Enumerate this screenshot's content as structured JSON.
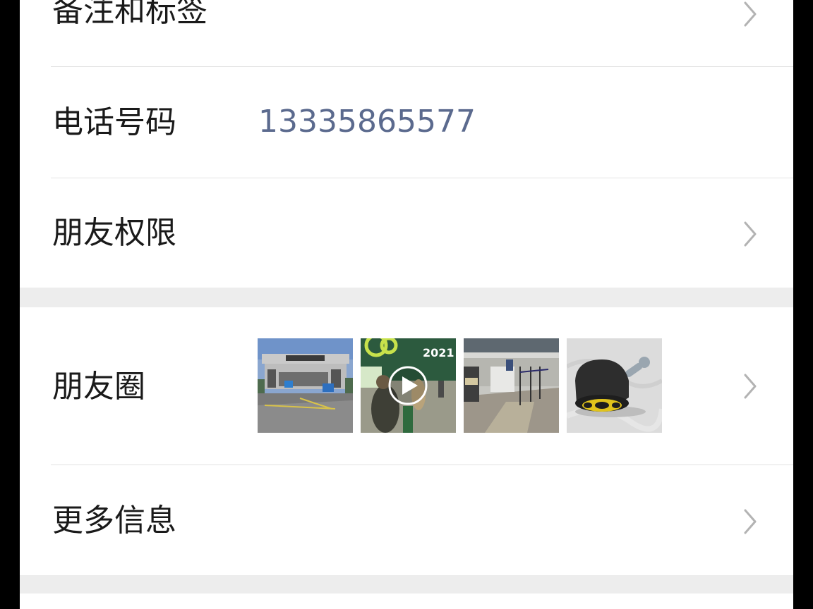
{
  "rows": {
    "remark": {
      "label": "备注和标签"
    },
    "phone": {
      "label": "电话号码",
      "value": "13335865577"
    },
    "permission": {
      "label": "朋友权限"
    },
    "moments": {
      "label": "朋友圈",
      "photo2_year": "2021"
    },
    "more": {
      "label": "更多信息"
    }
  },
  "icons": {
    "chevron": "chevron-right-icon",
    "play": "play-icon"
  },
  "colors": {
    "background": "#ededed",
    "card": "#ffffff",
    "label": "#1a1a1a",
    "phone_value": "#5b6a8e",
    "chevron": "#b3b3b3",
    "divider": "#e2e2e2"
  }
}
